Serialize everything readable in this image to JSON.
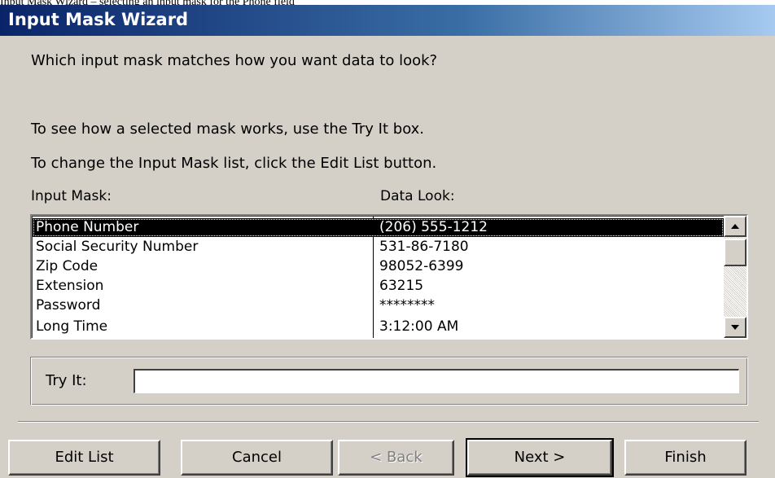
{
  "page_caption": "Input Mask Wizard – selecting an input mask for the Phone field",
  "window": {
    "title": "Input Mask Wizard"
  },
  "instructions": {
    "question": "Which input mask matches how you want data to look?",
    "tryit_hint": "To see how a selected mask works, use the Try It box.",
    "edit_hint": "To change the Input Mask list, click the Edit List button."
  },
  "list": {
    "col1_header": "Input Mask:",
    "col2_header": "Data Look:",
    "selected_index": 0,
    "rows": [
      {
        "mask": "Phone Number",
        "look": "(206) 555-1212"
      },
      {
        "mask": "Social Security Number",
        "look": "531-86-7180"
      },
      {
        "mask": "Zip Code",
        "look": "98052-6399"
      },
      {
        "mask": "Extension",
        "look": "63215"
      },
      {
        "mask": "Password",
        "look": "********"
      },
      {
        "mask": "Long Time",
        "look": "3:12:00 AM"
      }
    ]
  },
  "tryit": {
    "label": "Try It:",
    "value": ""
  },
  "buttons": {
    "edit_list": "Edit List",
    "cancel": "Cancel",
    "back": "< Back",
    "next": "Next >",
    "finish": "Finish"
  },
  "icons": {
    "scroll_up": "scroll-up-arrow-icon",
    "scroll_down": "scroll-down-arrow-icon"
  },
  "colors": {
    "title_start": "#0a246a",
    "title_end": "#a6caf0",
    "face": "#d4d0c8",
    "selection": "#000000"
  }
}
